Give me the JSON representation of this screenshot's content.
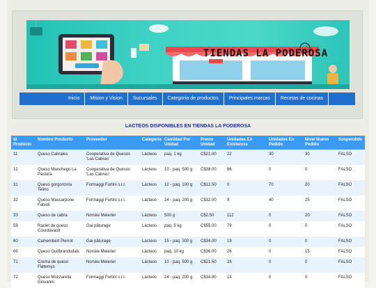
{
  "banner": {
    "title": "TIENDAS LA PODEROSA"
  },
  "nav": {
    "items": [
      "Inicio",
      "Mision y Vision",
      "Sucursales",
      "Categoría de productos",
      "Principales marcas",
      "Recetas de cocinas"
    ]
  },
  "page": {
    "title": "LACTEOS DISPONIBLES EN TIENDAS LA PODEROSA"
  },
  "table": {
    "headers": [
      "Id Producto",
      "Nombre Producto",
      "Proveedor",
      "Categoría",
      "Cantidad Por Unidad",
      "Precio Unidad",
      "Unidades En Existencia",
      "Unidades En Pedido",
      "Nivel Nuevo Pedido",
      "Suspendido"
    ],
    "rows": [
      [
        "11",
        "Queso Cabrales",
        "Cooperativa de Quesos 'Las Cabras'",
        "Lácteos",
        "paq. 1 kg",
        "C$21.00",
        "22",
        "30",
        "30",
        "FALSO"
      ],
      [
        "12",
        "Queso Manchego La Pastora",
        "Cooperativa de Quesos 'Las Cabras'",
        "Lácteos",
        "10 - paq. 500 g",
        "C$38.00",
        "86",
        "0",
        "0",
        "FALSO"
      ],
      [
        "31",
        "Queso gorgonzola Telino",
        "Formaggi Fortini s.r.l.",
        "Lácteos",
        "12 - paq. 100 g",
        "C$12.50",
        "0",
        "70",
        "20",
        "FALSO"
      ],
      [
        "32",
        "Queso Mascarpone Fabioli",
        "Formaggi Fortini s.r.l.",
        "Lácteos",
        "24 - paq. 200 g",
        "C$32.00",
        "9",
        "40",
        "25",
        "FALSO"
      ],
      [
        "33",
        "Queso de cabra",
        "Norske Meierier",
        "Lácteos",
        "500 g",
        "C$2.50",
        "112",
        "0",
        "20",
        "FALSO"
      ],
      [
        "59",
        "Raclet de queso Courdavault",
        "Gai pâturage",
        "Lácteos",
        "paq. 5 kg",
        "C$55.00",
        "79",
        "0",
        "0",
        "FALSO"
      ],
      [
        "60",
        "Camembert Pierrot",
        "Gai pâturage",
        "Lácteos",
        "15 - paq. 300 g",
        "C$34.00",
        "19",
        "0",
        "0",
        "FALSO"
      ],
      [
        "69",
        "Queso Gudbrandsdals",
        "Norske Meierier",
        "Lácteos",
        "paq. 10 kg",
        "C$36.00",
        "26",
        "0",
        "15",
        "FALSO"
      ],
      [
        "71",
        "Crema de queso Fløtemys",
        "Norske Meierier",
        "Lácteos",
        "10 - paq. 500 g",
        "C$21.50",
        "26",
        "0",
        "0",
        "FALSO"
      ],
      [
        "72",
        "Queso Mozzarella Giovanni",
        "Formaggi Fortini s.r.l.",
        "Lácteos",
        "24 - paq. 200 g",
        "C$34.80",
        "14",
        "0",
        "0",
        "FALSO"
      ]
    ]
  },
  "colors": {
    "nav": "#1f6fd0",
    "table_header": "#3a9bf6",
    "title": "#1a2d8f",
    "banner": "#2cc5b8"
  }
}
